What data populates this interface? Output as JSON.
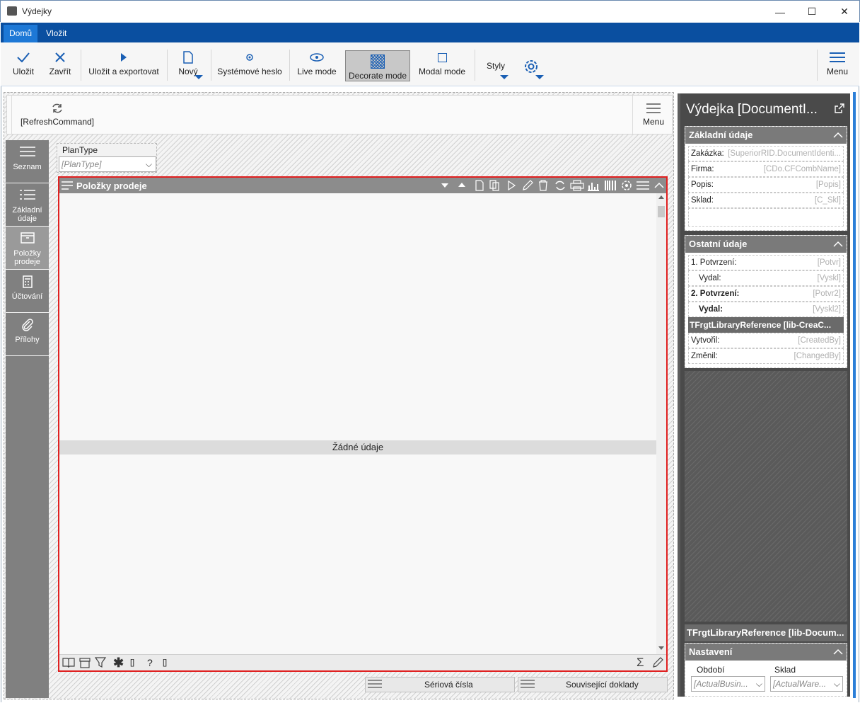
{
  "window": {
    "title": "Výdejky",
    "minimize": "—",
    "maximize": "☐",
    "close": "✕"
  },
  "ribbon": {
    "tabs": [
      {
        "label": "Domů",
        "active": true
      },
      {
        "label": "Vložit",
        "active": false
      }
    ],
    "buttons": {
      "save": "Uložit",
      "close": "Zavřít",
      "save_export": "Uložit a exportovat",
      "new": "Nový",
      "system_password": "Systémové heslo",
      "live_mode": "Live mode",
      "decorate_mode": "Decorate mode",
      "modal_mode": "Modal mode",
      "styles": "Styly",
      "menu": "Menu"
    }
  },
  "command_bar": {
    "refresh": "[RefreshCommand]",
    "menu": "Menu"
  },
  "sidenav": {
    "items": [
      {
        "label": "Seznam",
        "icon": "hamburger-icon",
        "active": false
      },
      {
        "label": "Základní údaje",
        "icon": "list-icon",
        "active": false
      },
      {
        "label": "Položky prodeje",
        "icon": "box-icon",
        "active": true
      },
      {
        "label": "Účtování",
        "icon": "calculator-icon",
        "active": false
      },
      {
        "label": "Přílohy",
        "icon": "paperclip-icon",
        "active": false
      }
    ]
  },
  "filter": {
    "label": "PlanType",
    "placeholder": "[PlanType]"
  },
  "grid": {
    "title": "Položky prodeje",
    "empty_text": "Žádné údaje",
    "footer_brackets_1": "[]",
    "footer_brackets_2": "[]",
    "footer_help": "?"
  },
  "bottom_buttons": {
    "serial": "Sériová čísla",
    "related": "Související doklady"
  },
  "panel": {
    "title": "Výdejka [DocumentI...",
    "sections": {
      "basic": {
        "title": "Základní údaje",
        "fields": [
          {
            "label": "Zakázka:",
            "value": "[SuperiorRID.DocumentIdenti..."
          },
          {
            "label": "Firma:",
            "value": "[CDo.CFCombName]"
          },
          {
            "label": "Popis:",
            "value": "[Popis]"
          },
          {
            "label": "Sklad:",
            "value": "[C_Skl]"
          }
        ]
      },
      "other": {
        "title": "Ostatní údaje",
        "fields": [
          {
            "label": "1. Potvrzení:",
            "value": "[Potvr]"
          },
          {
            "label": "Vydal:",
            "value": "[Vyskl]"
          },
          {
            "label": "2. Potvrzení:",
            "value": "[Potvr2]"
          },
          {
            "label": "Vydal:",
            "value": "[Vyskl2]"
          }
        ],
        "lib_ref": "TFrgtLibraryReference [lib-CreaC...",
        "fields2": [
          {
            "label": "Vytvořil:",
            "value": "[CreatedBy]"
          },
          {
            "label": "Změnil:",
            "value": "[ChangedBy]"
          }
        ]
      },
      "lib_doc": "TFrgtLibraryReference [lib-Docum...",
      "settings": {
        "title": "Nastavení",
        "period_label": "Období",
        "period_placeholder": "[ActualBusin...",
        "store_label": "Sklad",
        "store_placeholder": "[ActualWare..."
      }
    }
  },
  "colors": {
    "ribbon_blue": "#0a4fa0",
    "active_tab": "#1d78d6",
    "accent_icon": "#1a5fb4",
    "grid_border": "#e02020"
  }
}
